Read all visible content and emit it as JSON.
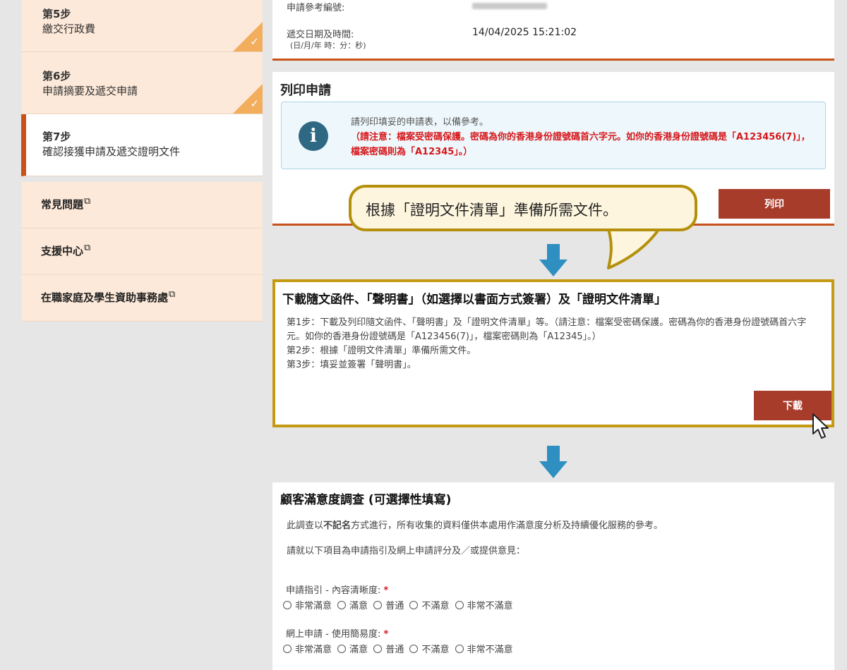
{
  "sidebar": {
    "steps": [
      {
        "num": "第5步",
        "title": "繳交行政費",
        "state": "done"
      },
      {
        "num": "第6步",
        "title": "申請摘要及遞交申請",
        "state": "done"
      },
      {
        "num": "第7步",
        "title": "確認接獲申請及遞交證明文件",
        "state": "current"
      }
    ],
    "links": [
      {
        "label": "常見問題",
        "ext_icon": "external-link-icon"
      },
      {
        "label": "支援中心",
        "ext_icon": "external-link-icon"
      },
      {
        "label": "在職家庭及學生資助事務處",
        "ext_icon": "external-link-icon"
      }
    ]
  },
  "top_panel": {
    "ref_label": "申請參考編號:",
    "submitted_label": "遞交日期及時間:",
    "submitted_format": "(日/月/年 時：分：秒)",
    "submitted_value": "14/04/2025 15:21:02"
  },
  "print_panel": {
    "title": "列印申請",
    "info_line1": "請列印填妥的申請表，以備參考。",
    "info_red": "（請注意：檔案受密碼保護。密碼為你的香港身份證號碼首六字元。如你的香港身份證號碼是「A123456(7)」，檔案密碼則為「A12345」。）",
    "button": "列印"
  },
  "callout": {
    "text": "根據「證明文件清單」準備所需文件。"
  },
  "download_panel": {
    "title": "下載隨文函件、「聲明書」（如選擇以書面方式簽署）及「證明文件清單」",
    "line1": "第1步：下載及列印隨文函件、「聲明書」及「證明文件清單」等。（請注意：檔案受密碼保護。密碼為你的香港身份證號碼首六字元。如你的香港身份證號碼是「A123456(7)」，檔案密碼則為「A12345」。）",
    "line2": "第2步：根據「證明文件清單」準備所需文件。",
    "line3": "第3步：填妥並簽署「聲明書」。",
    "button": "下載"
  },
  "survey": {
    "title": "顧客滿意度調查 (可選擇性填寫)",
    "intro_pre": "此調查以",
    "intro_bold": "不記名",
    "intro_post": "方式進行，所有收集的資料僅供本處用作滿意度分析及持續優化服務的參考。",
    "instruction": "請就以下項目為申請指引及網上申請評分及／或提供意見：",
    "questions": [
      {
        "label": "申請指引 - 內容清晰度:",
        "required": "*"
      },
      {
        "label": "網上申請 - 使用簡易度:",
        "required": "*"
      }
    ],
    "options": [
      "非常滿意",
      "滿意",
      "普通",
      "不滿意",
      "非常不滿意"
    ]
  },
  "colors": {
    "accent": "#c9521a",
    "button": "#a83c2b",
    "highlight_border": "#c49a12",
    "arrow": "#2f8fc0",
    "info_icon": "#2e6883",
    "warning_text": "#d6171b"
  }
}
